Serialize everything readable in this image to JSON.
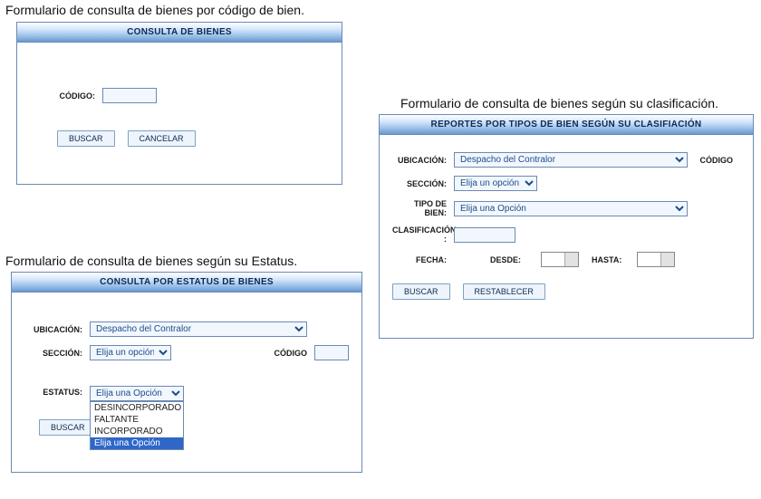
{
  "captions": {
    "form_codigo": "Formulario de consulta de bienes por código de bien.",
    "form_estatus": "Formulario de consulta de bienes según su  Estatus.",
    "form_clasificacion": "Formulario de consulta de bienes según su clasificación."
  },
  "form1": {
    "title": "CONSULTA DE BIENES",
    "codigo_label": "CÓDIGO:",
    "codigo_value": "",
    "buscar": "BUSCAR",
    "cancelar": "CANCELAR"
  },
  "form2": {
    "title": "CONSULTA POR ESTATUS DE BIENES",
    "ubicacion_label": "UBICACIÓN:",
    "ubicacion_value": "Despacho del Contralor",
    "seccion_label": "SECCIÓN:",
    "seccion_value": "Elija un opción",
    "codigo_label": "CÓDIGO",
    "codigo_value": "",
    "estatus_label": "ESTATUS:",
    "estatus_value": "Elija una Opción",
    "estatus_options": {
      "o0": "DESINCORPORADO",
      "o1": "FALTANTE",
      "o2": "INCORPORADO",
      "o3": "Elija una Opción"
    },
    "buscar": "BUSCAR"
  },
  "form3": {
    "title": "REPORTES POR TIPOS DE BIEN SEGÚN SU CLASIFIACIÓN",
    "ubicacion_label": "UBICACIÓN:",
    "ubicacion_value": "Despacho del Contralor",
    "codigo_label": "CÓDIGO",
    "seccion_label": "SECCIÓN:",
    "seccion_value": "Elija un opción",
    "tipo_label": "TIPO DE BIEN:",
    "tipo_value": "Elija una Opción",
    "clasif_label": "CLASIFICACIÓN :",
    "clasif_value": "",
    "fecha_label": "FECHA:",
    "desde_label": "DESDE:",
    "hasta_label": "HASTA:",
    "buscar": "BUSCAR",
    "restablecer": "RESTABLECER"
  }
}
